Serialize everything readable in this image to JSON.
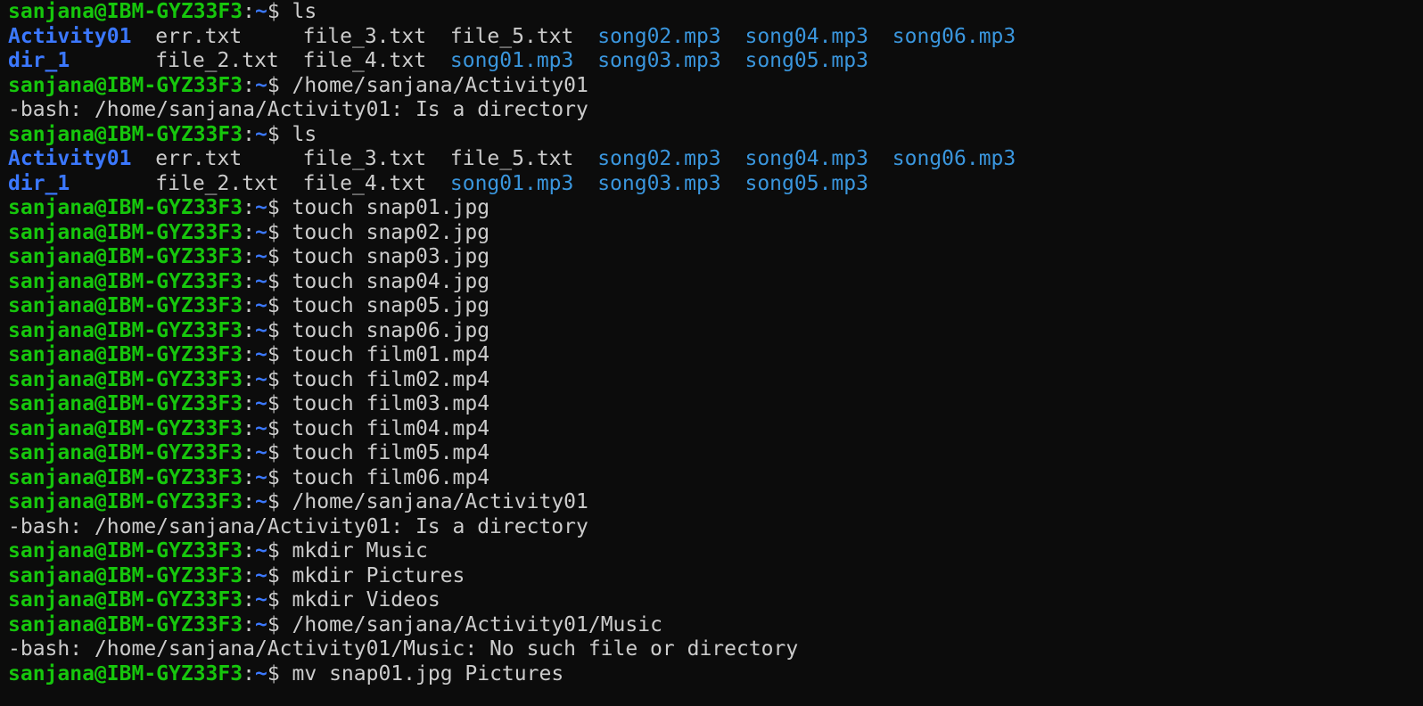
{
  "prompt": {
    "user_host": "sanjana@IBM-GYZ33F3",
    "colon": ":",
    "path": "~",
    "dollar": "$ "
  },
  "colors": {
    "background": "#0c0c0c",
    "prompt_green": "#16c60c",
    "directory_blue": "#3b78ff",
    "media_blue": "#3a96dd",
    "text_gray": "#cccccc"
  },
  "lines": [
    {
      "type": "prompt",
      "command": "ls"
    },
    {
      "type": "ls",
      "cells": [
        {
          "text": "Activity01",
          "kind": "dir"
        },
        {
          "text": "err.txt",
          "kind": "plain"
        },
        {
          "text": "file_3.txt",
          "kind": "plain"
        },
        {
          "text": "file_5.txt",
          "kind": "plain"
        },
        {
          "text": "song02.mp3",
          "kind": "media"
        },
        {
          "text": "song04.mp3",
          "kind": "media"
        },
        {
          "text": "song06.mp3",
          "kind": "media"
        }
      ]
    },
    {
      "type": "ls",
      "cells": [
        {
          "text": "dir_1",
          "kind": "dir"
        },
        {
          "text": "file_2.txt",
          "kind": "plain"
        },
        {
          "text": "file_4.txt",
          "kind": "plain"
        },
        {
          "text": "song01.mp3",
          "kind": "media"
        },
        {
          "text": "song03.mp3",
          "kind": "media"
        },
        {
          "text": "song05.mp3",
          "kind": "media"
        }
      ]
    },
    {
      "type": "prompt",
      "command": "/home/sanjana/Activity01"
    },
    {
      "type": "output",
      "text": "-bash: /home/sanjana/Activity01: Is a directory"
    },
    {
      "type": "prompt",
      "command": "ls"
    },
    {
      "type": "ls",
      "cells": [
        {
          "text": "Activity01",
          "kind": "dir"
        },
        {
          "text": "err.txt",
          "kind": "plain"
        },
        {
          "text": "file_3.txt",
          "kind": "plain"
        },
        {
          "text": "file_5.txt",
          "kind": "plain"
        },
        {
          "text": "song02.mp3",
          "kind": "media"
        },
        {
          "text": "song04.mp3",
          "kind": "media"
        },
        {
          "text": "song06.mp3",
          "kind": "media"
        }
      ]
    },
    {
      "type": "ls",
      "cells": [
        {
          "text": "dir_1",
          "kind": "dir"
        },
        {
          "text": "file_2.txt",
          "kind": "plain"
        },
        {
          "text": "file_4.txt",
          "kind": "plain"
        },
        {
          "text": "song01.mp3",
          "kind": "media"
        },
        {
          "text": "song03.mp3",
          "kind": "media"
        },
        {
          "text": "song05.mp3",
          "kind": "media"
        }
      ]
    },
    {
      "type": "prompt",
      "command": "touch snap01.jpg"
    },
    {
      "type": "prompt",
      "command": "touch snap02.jpg"
    },
    {
      "type": "prompt",
      "command": "touch snap03.jpg"
    },
    {
      "type": "prompt",
      "command": "touch snap04.jpg"
    },
    {
      "type": "prompt",
      "command": "touch snap05.jpg"
    },
    {
      "type": "prompt",
      "command": "touch snap06.jpg"
    },
    {
      "type": "prompt",
      "command": "touch film01.mp4"
    },
    {
      "type": "prompt",
      "command": "touch film02.mp4"
    },
    {
      "type": "prompt",
      "command": "touch film03.mp4"
    },
    {
      "type": "prompt",
      "command": "touch film04.mp4"
    },
    {
      "type": "prompt",
      "command": "touch film05.mp4"
    },
    {
      "type": "prompt",
      "command": "touch film06.mp4"
    },
    {
      "type": "prompt",
      "command": "/home/sanjana/Activity01"
    },
    {
      "type": "output",
      "text": "-bash: /home/sanjana/Activity01: Is a directory"
    },
    {
      "type": "prompt",
      "command": "mkdir Music"
    },
    {
      "type": "prompt",
      "command": "mkdir Pictures"
    },
    {
      "type": "prompt",
      "command": "mkdir Videos"
    },
    {
      "type": "prompt",
      "command": "/home/sanjana/Activity01/Music"
    },
    {
      "type": "output",
      "text": "-bash: /home/sanjana/Activity01/Music: No such file or directory"
    },
    {
      "type": "prompt",
      "command": "mv snap01.jpg Pictures"
    }
  ]
}
